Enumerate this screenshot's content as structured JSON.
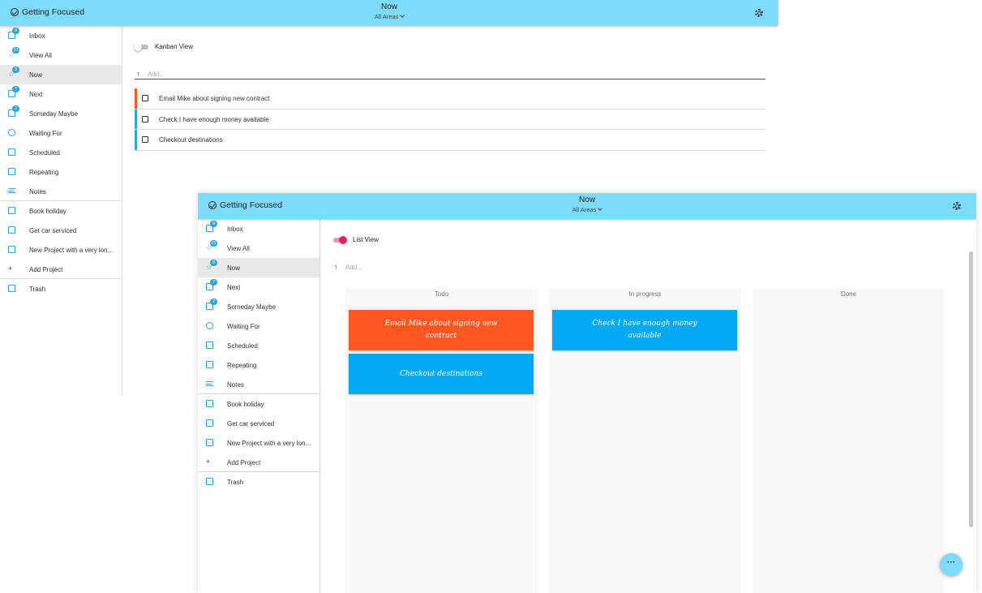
{
  "app": {
    "name": "Getting Focused",
    "view_title": "Now",
    "area_selector": "All Areas"
  },
  "colors": {
    "appbar": "#7fdbfa",
    "accent": "#29a6e0",
    "toggle_on": "#e91e63",
    "card_orange": "#ff5722",
    "card_blue": "#03a9f4"
  },
  "sidebar": {
    "items": [
      {
        "label": "Inbox",
        "icon": "inbox-icon",
        "badge": "9"
      },
      {
        "label": "View All",
        "icon": "star-icon",
        "badge": "21"
      },
      {
        "label": "Now",
        "icon": "star-icon",
        "badge": "3",
        "active": true
      },
      {
        "label": "Next",
        "icon": "next-icon",
        "badge": "7"
      },
      {
        "label": "Someday Maybe",
        "icon": "folder-icon",
        "badge": "2"
      },
      {
        "label": "Waiting For",
        "icon": "timer-icon"
      },
      {
        "label": "Scheduled",
        "icon": "calendar-icon"
      },
      {
        "label": "Repeating",
        "icon": "repeat-icon"
      },
      {
        "label": "Notes",
        "icon": "notes-icon"
      },
      {
        "label": "Book holiday",
        "icon": "project-icon"
      },
      {
        "label": "Get car serviced",
        "icon": "project-icon"
      },
      {
        "label": "New Project with a very lon...",
        "icon": "project-icon"
      },
      {
        "label": "Add Project",
        "icon": "plus-icon"
      },
      {
        "label": "Trash",
        "icon": "trash-icon"
      }
    ]
  },
  "list_window": {
    "toggle_label": "Kanban View",
    "add_placeholder": "Add...",
    "tasks": [
      {
        "text": "Email Mike about signing new contract",
        "color": "#ff5722"
      },
      {
        "text": "Check I have enough money available",
        "color": "#29a6e0"
      },
      {
        "text": "Checkout destinations",
        "color": "#29a6e0"
      }
    ]
  },
  "kanban_window": {
    "toggle_label": "List View",
    "add_placeholder": "Add...",
    "columns": [
      {
        "title": "Todo",
        "cards": [
          {
            "text": "Email Mike about signing new contract",
            "color": "#ff5722"
          },
          {
            "text": "Checkout destinations",
            "color": "#03a9f4"
          }
        ]
      },
      {
        "title": "In progress",
        "cards": [
          {
            "text": "Check I have enough money available",
            "color": "#03a9f4"
          }
        ]
      },
      {
        "title": "Done",
        "cards": []
      }
    ],
    "fab_icon": "more-horiz-icon"
  }
}
